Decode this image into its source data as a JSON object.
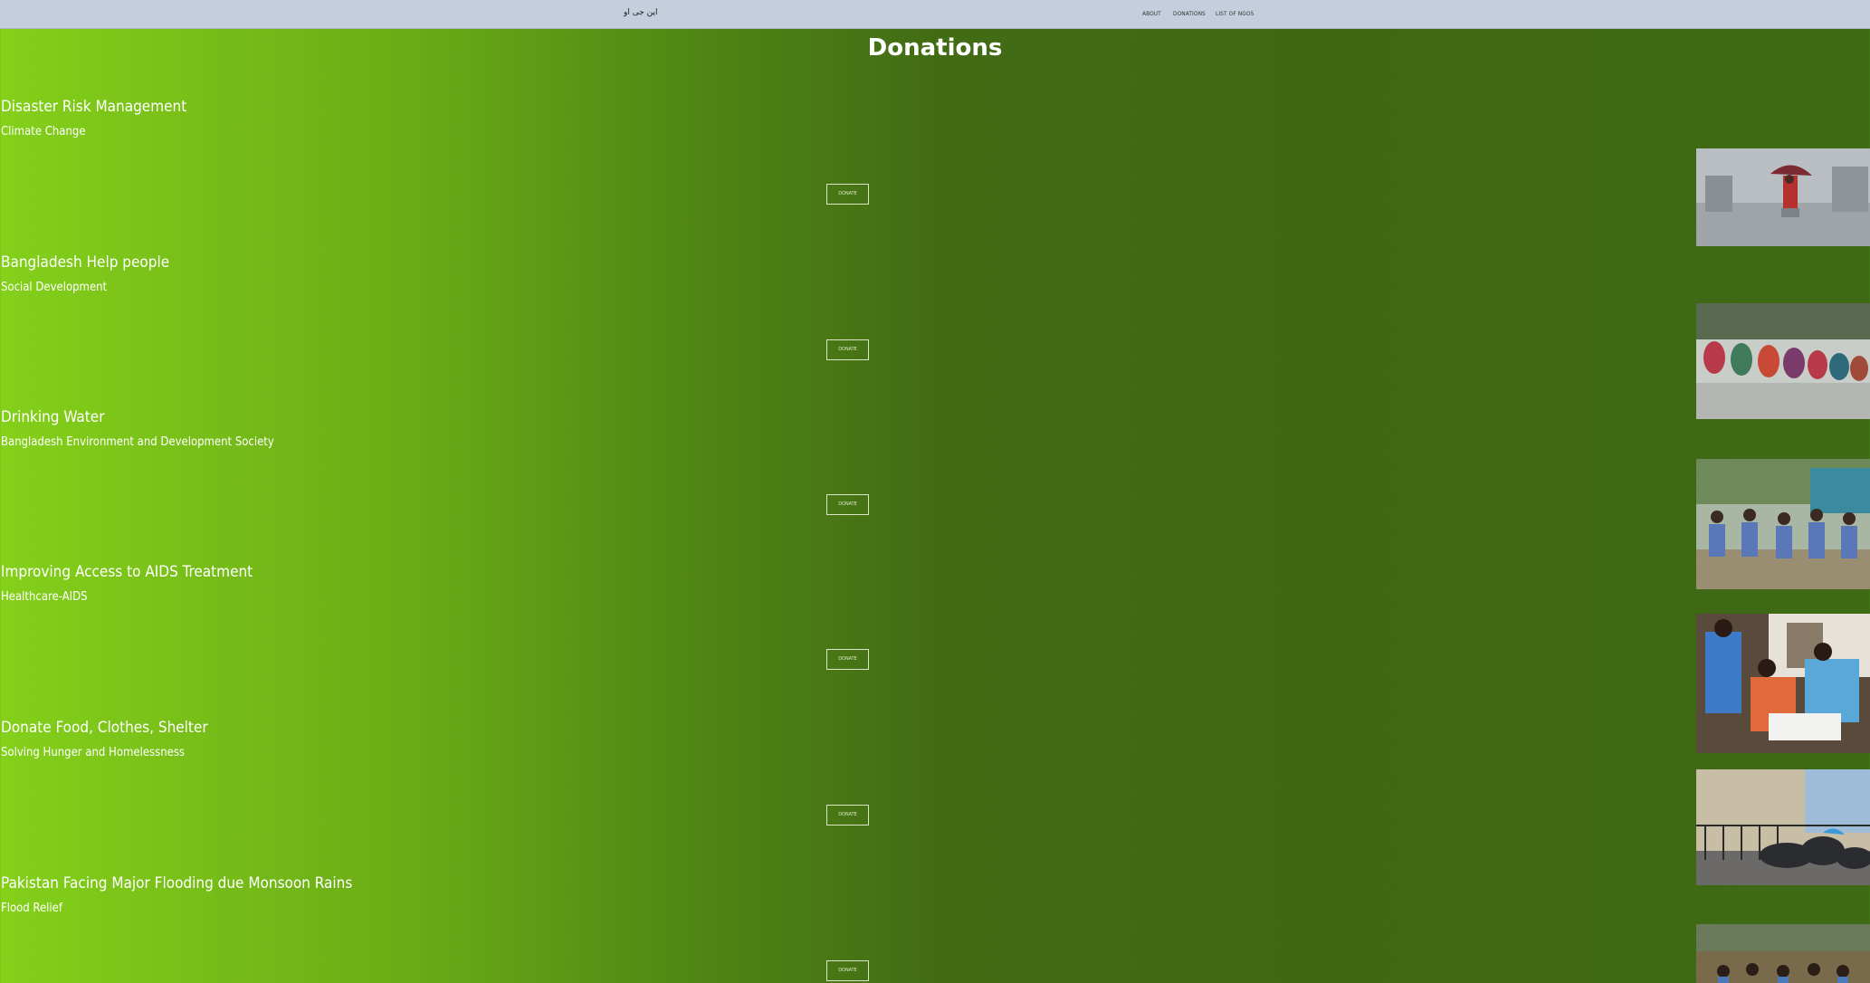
{
  "nav": {
    "brand": "این جی او",
    "links": [
      "ABOUT",
      "DONATIONS",
      "LIST OF NGOS"
    ]
  },
  "page": {
    "title": "Donations"
  },
  "donations": [
    {
      "title": "Disaster Risk Management",
      "category": "Climate Change",
      "button": "DONATE",
      "image": "flood-woman-umbrella-photo"
    },
    {
      "title": "Bangladesh Help people",
      "category": "Social Development",
      "button": "DONATE",
      "image": "crowd-seated-photo"
    },
    {
      "title": "Drinking Water",
      "category": "Bangladesh Environment and Development Society",
      "button": "DONATE",
      "image": "children-drinking-photo"
    },
    {
      "title": "Improving Access to AIDS Treatment",
      "category": "Healthcare-AIDS",
      "button": "DONATE",
      "image": "health-workers-photo"
    },
    {
      "title": "Donate Food, Clothes, Shelter",
      "category": "Solving Hunger and Homelessness",
      "button": "DONATE",
      "image": "homeless-street-photo"
    },
    {
      "title": "Pakistan Facing Major Flooding due Monsoon Rains",
      "category": "Flood Relief",
      "button": "DONATE",
      "image": "flood-children-photo"
    }
  ],
  "colors": {
    "bg_left": "#84d01a",
    "bg_right": "#3e6714",
    "navbar": "#c4cedc",
    "text": "#ffffff"
  }
}
